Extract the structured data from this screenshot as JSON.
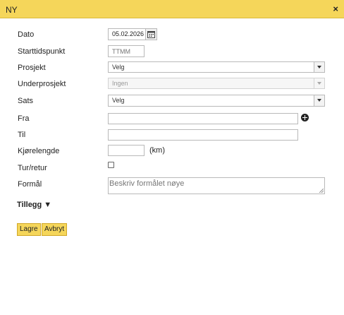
{
  "dialog": {
    "title": "NY",
    "close_label": "×"
  },
  "fields": {
    "dato": {
      "label": "Dato",
      "value": "05.02.2026"
    },
    "starttidspunkt": {
      "label": "Starttidspunkt",
      "placeholder": "TTMM"
    },
    "prosjekt": {
      "label": "Prosjekt",
      "value": "Velg"
    },
    "underprosjekt": {
      "label": "Underprosjekt",
      "value": "Ingen"
    },
    "sats": {
      "label": "Sats",
      "value": "Velg"
    },
    "fra": {
      "label": "Fra",
      "value": ""
    },
    "til": {
      "label": "Til",
      "value": ""
    },
    "kjorelengde": {
      "label": "Kjørelengde",
      "value": "",
      "unit": "(km)"
    },
    "turretur": {
      "label": "Tur/retur",
      "checked": false
    },
    "formal": {
      "label": "Formål",
      "placeholder": "Beskriv formålet nøye"
    }
  },
  "tillegg": {
    "label": "Tillegg ▼"
  },
  "buttons": {
    "save": "Lagre",
    "cancel": "Avbryt"
  },
  "colors": {
    "header": "#f5d65a",
    "button": "#f5d65a"
  },
  "icons": {
    "calendar": "calendar-icon",
    "add": "plus-circle-icon",
    "close": "close-icon"
  }
}
